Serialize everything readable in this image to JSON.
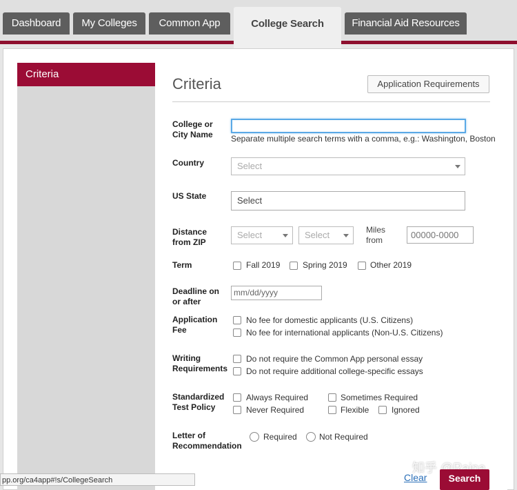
{
  "tabs": [
    {
      "label": "Dashboard"
    },
    {
      "label": "My Colleges"
    },
    {
      "label": "Common App"
    },
    {
      "label": "College Search"
    },
    {
      "label": "Financial Aid Resources"
    }
  ],
  "sidebar": {
    "header": "Criteria"
  },
  "main": {
    "title": "Criteria",
    "app_req_button": "Application Requirements"
  },
  "college_name": {
    "label_line1": "College or",
    "label_line2": "City Name",
    "value": "",
    "hint": "Separate multiple search terms with a comma, e.g.: Washington, Boston"
  },
  "country": {
    "label": "Country",
    "value": "Select"
  },
  "us_state": {
    "label": "US State",
    "value": "Select"
  },
  "distance": {
    "label_line1": "Distance",
    "label_line2": "from ZIP",
    "select1": "Select",
    "select2": "Select",
    "miles_line1": "Miles",
    "miles_line2": "from",
    "zip_placeholder": "00000-0000"
  },
  "term": {
    "label": "Term",
    "options": [
      "Fall 2019",
      "Spring 2019",
      "Other 2019"
    ]
  },
  "deadline": {
    "label_line1": "Deadline on",
    "label_line2": "or after",
    "placeholder": "mm/dd/yyyy"
  },
  "app_fee": {
    "label_line1": "Application",
    "label_line2": "Fee",
    "options": [
      "No fee for domestic applicants (U.S. Citizens)",
      "No fee for international applicants (Non-U.S. Citizens)"
    ]
  },
  "writing": {
    "label_line1": "Writing",
    "label_line2": "Requirements",
    "options": [
      "Do not require the Common App personal essay",
      "Do not require additional college-specific essays"
    ]
  },
  "test_policy": {
    "label_line1": "Standardized",
    "label_line2": "Test Policy",
    "options": [
      "Always Required",
      "Sometimes Required",
      "Never Required",
      "Flexible",
      "Ignored"
    ]
  },
  "recommendation": {
    "label_line1": "Letter of",
    "label_line2": "Recommendation",
    "options": [
      "Required",
      "Not Required"
    ]
  },
  "footer": {
    "url": "pp.org/ca4app#!s/CollegeSearch",
    "clear": "Clear",
    "search": "Search",
    "watermark": "知乎 @Raina"
  },
  "colors": {
    "brand": "#9b0c35",
    "tab_bg": "#5e5e5e",
    "link": "#2a6fb8"
  }
}
